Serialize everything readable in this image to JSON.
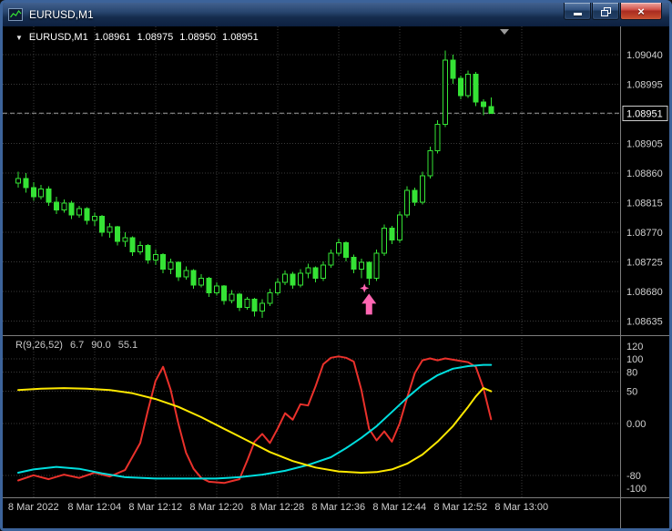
{
  "window": {
    "title": "EURUSD,M1",
    "close_glyph": "×"
  },
  "chart": {
    "collapse_arrow": "▼",
    "symbol_label": "EURUSD,M1",
    "ohlc": {
      "open": "1.08961",
      "high": "1.08975",
      "low": "1.08950",
      "close": "1.08951"
    },
    "current_price": "1.08951",
    "colors": {
      "background": "#000000",
      "grid": "#3a3a3a",
      "candle": "#35e335",
      "bull_fill": "#000000",
      "axis_text": "#d0d0d0",
      "separator": "#7d7d7d",
      "current_price_line": "#9a9a9a",
      "price_box_bg": "#000000",
      "price_box_border": "#cccccc",
      "shift_marker": "#9a9a9a"
    }
  },
  "indicator": {
    "name": "R(9,26,52)",
    "values": [
      "6.7",
      "90.0",
      "55.1"
    ],
    "ticks": [
      {
        "label": "120",
        "value": 120
      },
      {
        "label": "100",
        "value": 100
      },
      {
        "label": "80",
        "value": 80
      },
      {
        "label": "50",
        "value": 50
      },
      {
        "label": "0.00",
        "value": 0
      },
      {
        "label": "-80",
        "value": -80
      },
      {
        "label": "-100",
        "value": -100
      }
    ]
  },
  "annotations": {
    "buy_arrow": {
      "type": "up-arrow",
      "color": "#ff66b2",
      "bar_index": 46,
      "anchor_price": 1.08685
    }
  },
  "chart_data": [
    {
      "type": "candlestick",
      "title": "EURUSD,M1",
      "x_labels": [
        "8 Mar 2022",
        "8 Mar 12:04",
        "8 Mar 12:12",
        "8 Mar 12:20",
        "8 Mar 12:28",
        "8 Mar 12:36",
        "8 Mar 12:44",
        "8 Mar 12:52",
        "8 Mar 13:00"
      ],
      "label_slots": [
        2,
        10,
        18,
        26,
        34,
        42,
        50,
        58,
        66
      ],
      "ylim": [
        1.08614,
        1.09083
      ],
      "y_ticks": [
        1.0904,
        1.08995,
        1.0895,
        1.08905,
        1.0886,
        1.08815,
        1.0877,
        1.08725,
        1.0868,
        1.08635
      ],
      "grid": true,
      "ohlc": [
        [
          1.08845,
          1.08862,
          1.08838,
          1.08852
        ],
        [
          1.08852,
          1.0886,
          1.0883,
          1.08838
        ],
        [
          1.08838,
          1.08846,
          1.08818,
          1.08824
        ],
        [
          1.08824,
          1.08842,
          1.0882,
          1.08836
        ],
        [
          1.08836,
          1.0884,
          1.0881,
          1.08816
        ],
        [
          1.08816,
          1.08824,
          1.08798,
          1.08804
        ],
        [
          1.08804,
          1.0882,
          1.088,
          1.08814
        ],
        [
          1.08814,
          1.08818,
          1.0879,
          1.08796
        ],
        [
          1.08796,
          1.0881,
          1.08792,
          1.08806
        ],
        [
          1.08806,
          1.08808,
          1.08782,
          1.08788
        ],
        [
          1.08788,
          1.088,
          1.0878,
          1.08794
        ],
        [
          1.08794,
          1.08796,
          1.08764,
          1.0877
        ],
        [
          1.0877,
          1.08784,
          1.08762,
          1.08778
        ],
        [
          1.08778,
          1.0878,
          1.0875,
          1.08756
        ],
        [
          1.08756,
          1.0877,
          1.08748,
          1.08762
        ],
        [
          1.08762,
          1.08764,
          1.08734,
          1.0874
        ],
        [
          1.0874,
          1.08756,
          1.08736,
          1.0875
        ],
        [
          1.0875,
          1.08752,
          1.08722,
          1.08728
        ],
        [
          1.08728,
          1.08744,
          1.0872,
          1.08736
        ],
        [
          1.08736,
          1.08738,
          1.08708,
          1.08714
        ],
        [
          1.08714,
          1.0873,
          1.08706,
          1.08724
        ],
        [
          1.08724,
          1.08726,
          1.08696,
          1.08702
        ],
        [
          1.08702,
          1.08718,
          1.08698,
          1.08712
        ],
        [
          1.08712,
          1.08714,
          1.08684,
          1.0869
        ],
        [
          1.0869,
          1.08706,
          1.08686,
          1.087
        ],
        [
          1.087,
          1.08702,
          1.08672,
          1.08678
        ],
        [
          1.08678,
          1.08694,
          1.08674,
          1.08688
        ],
        [
          1.08688,
          1.0869,
          1.0866,
          1.08666
        ],
        [
          1.08666,
          1.08682,
          1.08662,
          1.08676
        ],
        [
          1.08676,
          1.08678,
          1.0865,
          1.08656
        ],
        [
          1.08656,
          1.08672,
          1.08652,
          1.08668
        ],
        [
          1.08668,
          1.0867,
          1.08642,
          1.0865
        ],
        [
          1.0865,
          1.08668,
          1.0864,
          1.08662
        ],
        [
          1.08662,
          1.08684,
          1.08658,
          1.08678
        ],
        [
          1.08678,
          1.087,
          1.08674,
          1.08694
        ],
        [
          1.08694,
          1.08712,
          1.0869,
          1.08706
        ],
        [
          1.08706,
          1.0871,
          1.08684,
          1.0869
        ],
        [
          1.0869,
          1.08714,
          1.08686,
          1.08708
        ],
        [
          1.08708,
          1.08722,
          1.087,
          1.08716
        ],
        [
          1.08716,
          1.08718,
          1.08694,
          1.087
        ],
        [
          1.087,
          1.08726,
          1.08696,
          1.0872
        ],
        [
          1.0872,
          1.08744,
          1.08716,
          1.08738
        ],
        [
          1.08738,
          1.0876,
          1.08734,
          1.08754
        ],
        [
          1.08754,
          1.08756,
          1.08726,
          1.08732
        ],
        [
          1.08732,
          1.08736,
          1.08708,
          1.08714
        ],
        [
          1.08714,
          1.0873,
          1.087,
          1.08724
        ],
        [
          1.08724,
          1.08726,
          1.0869,
          1.087
        ],
        [
          1.087,
          1.08744,
          1.08696,
          1.08738
        ],
        [
          1.08738,
          1.08782,
          1.08734,
          1.08776
        ],
        [
          1.08776,
          1.0878,
          1.08752,
          1.08758
        ],
        [
          1.08758,
          1.08802,
          1.08754,
          1.08796
        ],
        [
          1.08796,
          1.0884,
          1.08792,
          1.08834
        ],
        [
          1.08834,
          1.08838,
          1.0881,
          1.08816
        ],
        [
          1.08816,
          1.08862,
          1.08812,
          1.08856
        ],
        [
          1.08856,
          1.089,
          1.08852,
          1.08894
        ],
        [
          1.08894,
          1.0894,
          1.0889,
          1.08934
        ],
        [
          1.08934,
          1.09046,
          1.0893,
          1.09032
        ],
        [
          1.09032,
          1.0904,
          1.08996,
          1.09004
        ],
        [
          1.09004,
          1.09008,
          1.08972,
          1.08978
        ],
        [
          1.08978,
          1.09016,
          1.08974,
          1.0901
        ],
        [
          1.0901,
          1.09014,
          1.08962,
          1.08968
        ],
        [
          1.08968,
          1.08972,
          1.08948,
          1.08961
        ],
        [
          1.08961,
          1.08975,
          1.0895,
          1.08951
        ]
      ]
    },
    {
      "type": "line",
      "title": "R(9,26,52)",
      "ylim": [
        -100,
        120
      ],
      "levels": [
        100,
        80,
        50,
        0,
        -80
      ],
      "series": [
        {
          "name": "red",
          "color": "#ea312b",
          "points": [
            [
              0,
              -88
            ],
            [
              2,
              -80
            ],
            [
              4,
              -86
            ],
            [
              6,
              -79
            ],
            [
              8,
              -84
            ],
            [
              10,
              -76
            ],
            [
              12,
              -82
            ],
            [
              14,
              -72
            ],
            [
              16,
              -30
            ],
            [
              17,
              20
            ],
            [
              18,
              66
            ],
            [
              19,
              88
            ],
            [
              20,
              52
            ],
            [
              21,
              0
            ],
            [
              22,
              -45
            ],
            [
              23,
              -70
            ],
            [
              24,
              -84
            ],
            [
              25,
              -90
            ],
            [
              27,
              -92
            ],
            [
              29,
              -86
            ],
            [
              30,
              -58
            ],
            [
              31,
              -28
            ],
            [
              32,
              -16
            ],
            [
              33,
              -30
            ],
            [
              34,
              -8
            ],
            [
              35,
              16
            ],
            [
              36,
              6
            ],
            [
              37,
              30
            ],
            [
              38,
              28
            ],
            [
              39,
              58
            ],
            [
              40,
              92
            ],
            [
              41,
              102
            ],
            [
              42,
              104
            ],
            [
              43,
              102
            ],
            [
              44,
              96
            ],
            [
              45,
              52
            ],
            [
              46,
              -8
            ],
            [
              47,
              -26
            ],
            [
              48,
              -12
            ],
            [
              49,
              -28
            ],
            [
              50,
              0
            ],
            [
              51,
              40
            ],
            [
              52,
              78
            ],
            [
              53,
              98
            ],
            [
              54,
              101
            ],
            [
              55,
              98
            ],
            [
              56,
              101
            ],
            [
              57,
              99
            ],
            [
              58,
              97
            ],
            [
              59,
              95
            ],
            [
              60,
              88
            ],
            [
              61,
              55
            ],
            [
              62,
              6.7
            ]
          ]
        },
        {
          "name": "cyan",
          "color": "#00dede",
          "points": [
            [
              0,
              -76
            ],
            [
              2,
              -71
            ],
            [
              5,
              -67
            ],
            [
              8,
              -70
            ],
            [
              11,
              -77
            ],
            [
              14,
              -83
            ],
            [
              18,
              -85
            ],
            [
              22,
              -85
            ],
            [
              26,
              -85
            ],
            [
              29,
              -83
            ],
            [
              32,
              -79
            ],
            [
              35,
              -73
            ],
            [
              38,
              -64
            ],
            [
              41,
              -52
            ],
            [
              43,
              -38
            ],
            [
              45,
              -22
            ],
            [
              47,
              -4
            ],
            [
              49,
              18
            ],
            [
              51,
              40
            ],
            [
              53,
              60
            ],
            [
              55,
              75
            ],
            [
              57,
              85
            ],
            [
              59,
              89
            ],
            [
              61,
              91
            ],
            [
              62,
              91
            ]
          ]
        },
        {
          "name": "yellow",
          "color": "#ffe900",
          "points": [
            [
              0,
              52
            ],
            [
              3,
              54
            ],
            [
              6,
              55
            ],
            [
              9,
              54
            ],
            [
              12,
              52
            ],
            [
              15,
              47
            ],
            [
              18,
              38
            ],
            [
              21,
              26
            ],
            [
              24,
              10
            ],
            [
              27,
              -8
            ],
            [
              30,
              -26
            ],
            [
              33,
              -44
            ],
            [
              36,
              -58
            ],
            [
              39,
              -68
            ],
            [
              42,
              -74
            ],
            [
              45,
              -76
            ],
            [
              47,
              -75
            ],
            [
              49,
              -71
            ],
            [
              51,
              -62
            ],
            [
              53,
              -48
            ],
            [
              55,
              -28
            ],
            [
              57,
              -4
            ],
            [
              59,
              26
            ],
            [
              60,
              42
            ],
            [
              61,
              55
            ],
            [
              62,
              50
            ]
          ]
        }
      ]
    }
  ]
}
